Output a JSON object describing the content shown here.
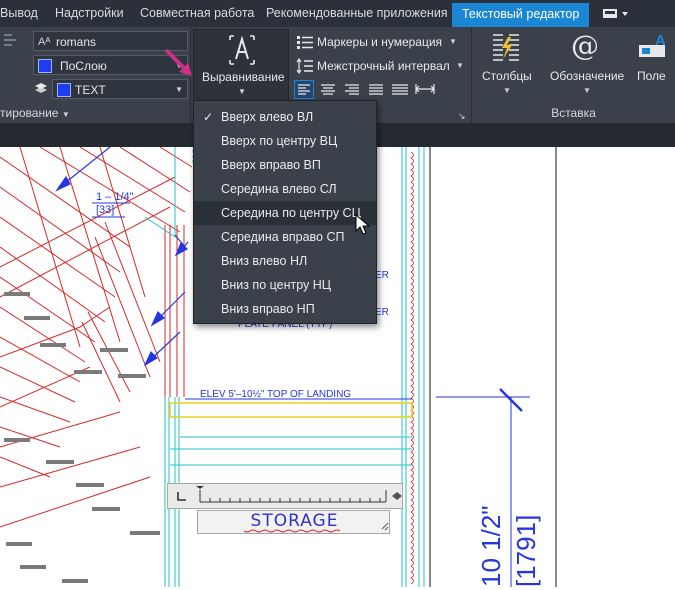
{
  "tabs": {
    "output": "Вывод",
    "settings": "Надстройки",
    "collab": "Совместная работа",
    "recommended": "Рекомендованные приложения",
    "text_editor": "Текстовый редактор"
  },
  "style": {
    "font": "romans",
    "color": "ПоСлою",
    "layer": "TEXT"
  },
  "ribbon": {
    "align_button": "Выравнивание",
    "markers": "Маркеры и нумерация",
    "line_spacing": "Межстрочный интервал",
    "columns": "Столбцы",
    "symbol": "Обозначение",
    "field": "Поле",
    "group_format": "тирование",
    "group_insert": "Вставка"
  },
  "menu": {
    "items": [
      {
        "label": "Вверх влево ВЛ",
        "checked": true
      },
      {
        "label": "Вверх по центру ВЦ"
      },
      {
        "label": "Вверх вправо ВП"
      },
      {
        "label": "Середина влево СЛ"
      },
      {
        "label": "Середина по центру СЦ",
        "hovered": true
      },
      {
        "label": "Середина вправо СП"
      },
      {
        "label": "Вниз влево НЛ"
      },
      {
        "label": "Вниз по центру НЦ"
      },
      {
        "label": "Вниз вправо НП"
      }
    ]
  },
  "drawing": {
    "dim1": "1 – 1/4\"",
    "dim1b": "[33]",
    "elev": "ELEV  5'–10½\"  TOP OF LANDING",
    "plate": "PLATE  PANEL  (TYP)",
    "er1": "ER",
    "er2": "ER",
    "storage": "STORAGE",
    "big_dim": "10  1/2\"",
    "big_dim_b": "[1791]"
  },
  "colors": {
    "accent": "#1a86d4",
    "ribbon": "#3b414b",
    "tabs": "#2b313a",
    "arrow": "#cc2f86"
  }
}
